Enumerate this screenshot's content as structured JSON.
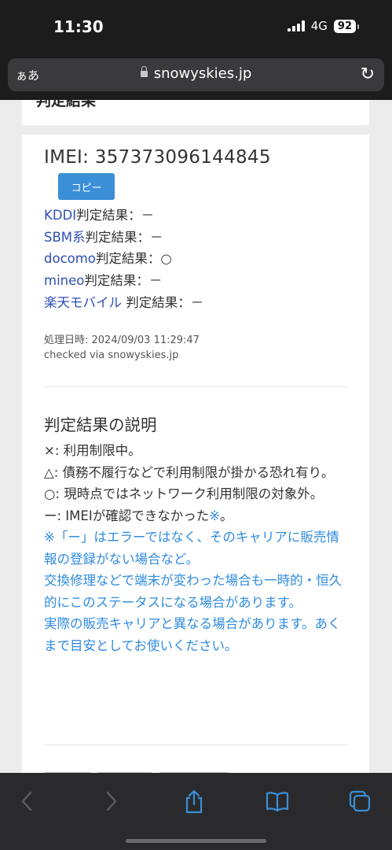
{
  "status_bar": {
    "time": "11:30",
    "network": "4G",
    "battery": "92"
  },
  "browser": {
    "aa_label": "ぁあ",
    "url": "snowyskies.jp"
  },
  "page": {
    "top_card_title": "判定結果",
    "imei_label": "IMEI: 357373096144845",
    "copy_button": "コピー",
    "results": [
      {
        "carrier": "KDDI",
        "suffix": "判定結果：－"
      },
      {
        "carrier": "SBM系",
        "suffix": "判定結果：－"
      },
      {
        "carrier": "docomo",
        "suffix": "判定結果：○"
      },
      {
        "carrier": "mineo",
        "suffix": "判定結果：－"
      },
      {
        "carrier": "楽天モバイル",
        "suffix": " 判定結果：－"
      }
    ],
    "processed_at": "処理日時: 2024/09/03 11:29:47",
    "checked_via": "checked via snowyskies.jp",
    "explanation_title": "判定結果の説明",
    "explanation": {
      "x_line": "×: 利用制限中。",
      "triangle_line": "△: 債務不履行などで利用制限が掛かる恐れ有り。",
      "circle_line": "○: 現時点ではネットワーク利用制限の対象外。",
      "dash_line_prefix": "ー: IMEIが確認できなかった",
      "dash_line_note_mark": "※",
      "dash_line_suffix": "。",
      "note1": "※「ー」はエラーではなく、そのキャリアに販売情報の登録がない場合など。",
      "note2": "交換修理などで端末が変わった場合も一時的・恒久的にこのステータスになる場合があります。",
      "note3": "実際の販売キャリアと異なる場合があります。あくまで目安としてお使いください。"
    }
  },
  "toolbar": {
    "icons": [
      "back-icon",
      "forward-icon",
      "share-icon",
      "bookmarks-icon",
      "tabs-icon"
    ],
    "color": "#3a8fd7"
  }
}
